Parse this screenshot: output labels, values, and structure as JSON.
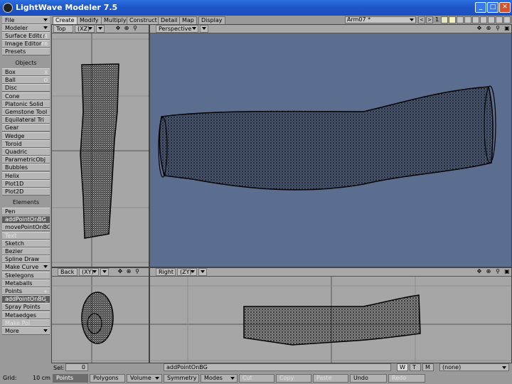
{
  "window": {
    "title": "LightWave Modeler 7.5",
    "minimize": "_",
    "maximize": "□",
    "close": "✕"
  },
  "tabs": [
    "Create",
    "Modify",
    "Multiply",
    "Construct",
    "Detail",
    "Map",
    "Display"
  ],
  "object_field": "Arm07 *",
  "layer_number": "1",
  "sidebar": {
    "file": "File",
    "modeler": "Modeler",
    "surface_editor": "Surface Editor",
    "surface_editor_sc": "F5",
    "image_editor": "Image Editor",
    "image_editor_sc": "F6",
    "presets": "Presets",
    "objects_head": "Objects",
    "objects": [
      {
        "label": "Box",
        "sc": "X"
      },
      {
        "label": "Ball",
        "sc": "O"
      },
      {
        "label": "Disc",
        "sc": ""
      },
      {
        "label": "Cone",
        "sc": ""
      },
      {
        "label": "Platonic Solid",
        "sc": ""
      },
      {
        "label": "Gemstone Tool",
        "sc": ""
      },
      {
        "label": "Equilateral Tri",
        "sc": ""
      },
      {
        "label": "Gear",
        "sc": ""
      },
      {
        "label": "Wedge",
        "sc": ""
      },
      {
        "label": "Toroid",
        "sc": ""
      },
      {
        "label": "Quadric",
        "sc": ""
      },
      {
        "label": "ParametricObj",
        "sc": ""
      },
      {
        "label": "Bubbles",
        "sc": ""
      },
      {
        "label": "Helix",
        "sc": ""
      },
      {
        "label": "Plot1D",
        "sc": ""
      },
      {
        "label": "Plot2D",
        "sc": ""
      }
    ],
    "elements_head": "Elements",
    "elements": [
      {
        "label": "Pen",
        "sc": ""
      },
      {
        "label": "addPointOnBG",
        "sc": ""
      },
      {
        "label": "movePointOnBG",
        "sc": ""
      },
      {
        "label": "Text",
        "sc": ""
      },
      {
        "label": "Sketch",
        "sc": ""
      },
      {
        "label": "Bezier",
        "sc": ""
      },
      {
        "label": "Spline Draw",
        "sc": ""
      },
      {
        "label": "Make Curve",
        "sc": ""
      },
      {
        "label": "Skelegons",
        "sc": ""
      },
      {
        "label": "Metaballs",
        "sc": ""
      },
      {
        "label": "Points",
        "sc": "+"
      },
      {
        "label": "addPointOnBG",
        "sc": "_"
      },
      {
        "label": "Spray Points",
        "sc": ""
      },
      {
        "label": "Metaedges",
        "sc": ""
      },
      {
        "label": "Make Pol",
        "sc": ""
      },
      {
        "label": "More",
        "sc": ""
      }
    ]
  },
  "viewports": {
    "top": {
      "label": "Top",
      "axis": "(XZ)"
    },
    "perspective": {
      "label": "Perspective"
    },
    "back": {
      "label": "Back",
      "axis": "(XY)"
    },
    "right": {
      "label": "Right",
      "axis": "(ZY)"
    }
  },
  "status": {
    "sel_label": "Sel:",
    "sel_value": "0",
    "tool_name": "addPointOnBG",
    "wtm": [
      "W",
      "T",
      "M"
    ],
    "surface": "(none)"
  },
  "bottom": {
    "grid_label": "Grid:",
    "grid_value": "10 cm",
    "points": "Points",
    "polygons": "Polygons",
    "volume": "Volume",
    "symmetry": "Symmetry",
    "modes": "Modes",
    "cut": "Cut",
    "copy": "Copy",
    "paste": "Paste",
    "undo": "Undo",
    "redo": "Redo"
  },
  "colors": {
    "perspective_bg": "#5b6e8f",
    "ortho_bg": "#a6a6a6",
    "title_bar": "#1f56c8"
  }
}
